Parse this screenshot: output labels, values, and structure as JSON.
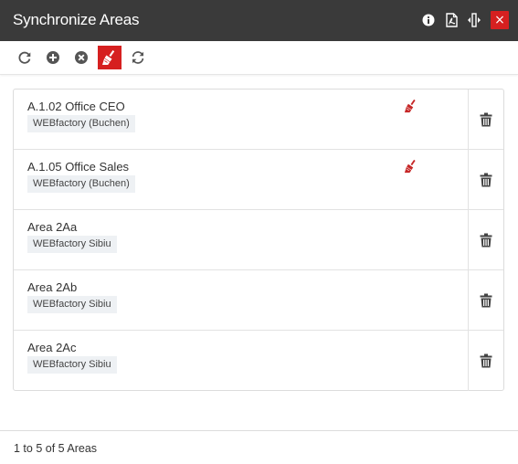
{
  "window": {
    "title": "Synchronize Areas",
    "close_glyph": "×",
    "header_icons": [
      "info-icon",
      "pdf-icon",
      "resize-horizontal-icon",
      "close-icon"
    ]
  },
  "toolbar": {
    "tools": [
      "refresh-icon",
      "add-circle-icon",
      "remove-circle-icon",
      "broom-icon",
      "sync-icon"
    ],
    "active_tool": "broom-icon"
  },
  "areas": [
    {
      "name": "A.1.02 Office CEO",
      "tag": "WEBfactory (Buchen)",
      "status_icon": "broom-icon"
    },
    {
      "name": "A.1.05 Office Sales",
      "tag": "WEBfactory (Buchen)",
      "status_icon": "broom-icon"
    },
    {
      "name": "Area 2Aa",
      "tag": "WEBfactory Sibiu"
    },
    {
      "name": "Area 2Ab",
      "tag": "WEBfactory Sibiu"
    },
    {
      "name": "Area 2Ac",
      "tag": "WEBfactory Sibiu"
    }
  ],
  "footer": {
    "summary": "1 to 5 of 5 Areas"
  },
  "colors": {
    "titlebar": "#3a3a3a",
    "accent": "#d62020",
    "tag_bg": "#eef1f4"
  }
}
